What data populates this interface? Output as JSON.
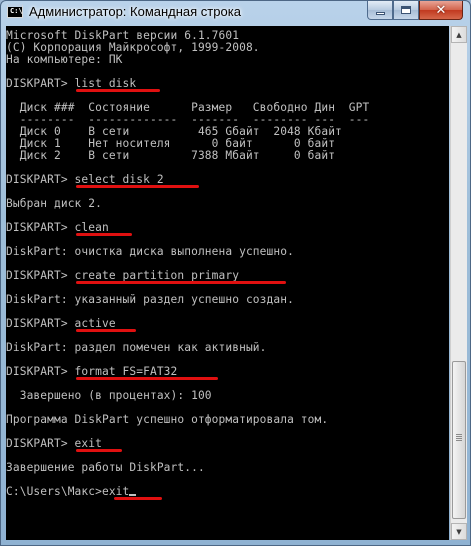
{
  "window": {
    "title": "Администратор: Командная строка",
    "close_glyph": "✕"
  },
  "console": {
    "lines": [
      "Microsoft DiskPart версии 6.1.7601",
      "(C) Корпорация Майкрософт, 1999-2008.",
      "На компьютере: ПК",
      "",
      "DISKPART> list disk",
      "",
      "  Диск ###  Состояние      Размер   Свободно Дин  GPT",
      "  --------  -------------  -------  -------- ---  ---",
      "  Диск 0    В сети          465 Gбайт  2048 Кбайт",
      "  Диск 1    Нет носителя      0 байт      0 байт",
      "  Диск 2    В сети         7388 Мбайт     0 байт",
      "",
      "DISKPART> select disk 2",
      "",
      "Выбран диск 2.",
      "",
      "DISKPART> clean",
      "",
      "DiskPart: очистка диска выполнена успешно.",
      "",
      "DISKPART> create partition primary",
      "",
      "DiskPart: указанный раздел успешно создан.",
      "",
      "DISKPART> active",
      "",
      "DiskPart: раздел помечен как активный.",
      "",
      "DISKPART> format FS=FAT32",
      "",
      "  Завершено (в процентах): 100",
      "",
      "Программа DiskPart успешно отформатировала том.",
      "",
      "DISKPART> exit",
      "",
      "Завершение работы DiskPart...",
      "",
      "C:\\Users\\Макс>exit"
    ]
  },
  "colors": {
    "console_background": "#000000",
    "console_text": "#c0c0c0",
    "annotation_underline": "#e01010"
  }
}
